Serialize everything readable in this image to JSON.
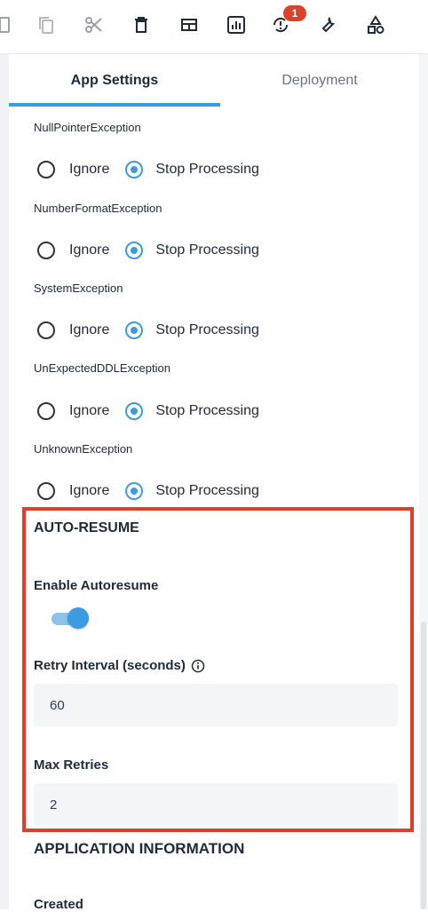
{
  "toolbar": {
    "icons": [
      "document-icon",
      "copy-icon",
      "cut-icon",
      "delete-icon",
      "layout-icon",
      "chart-icon",
      "sync-alert-icon",
      "wrench-icon",
      "shapes-icon"
    ],
    "badge_count": "1"
  },
  "tabs": [
    {
      "label": "App Settings",
      "active": true
    },
    {
      "label": "Deployment",
      "active": false
    }
  ],
  "exceptions": [
    {
      "name": "NullPointerException",
      "options": [
        "Ignore",
        "Stop Processing"
      ],
      "selected": "Stop Processing"
    },
    {
      "name": "NumberFormatException",
      "options": [
        "Ignore",
        "Stop Processing"
      ],
      "selected": "Stop Processing"
    },
    {
      "name": "SystemException",
      "options": [
        "Ignore",
        "Stop Processing"
      ],
      "selected": "Stop Processing"
    },
    {
      "name": "UnExpectedDDLException",
      "options": [
        "Ignore",
        "Stop Processing"
      ],
      "selected": "Stop Processing"
    },
    {
      "name": "UnknownException",
      "options": [
        "Ignore",
        "Stop Processing"
      ],
      "selected": "Stop Processing"
    }
  ],
  "auto_resume": {
    "title": "AUTO-RESUME",
    "enable_label": "Enable Autoresume",
    "enabled": true,
    "retry_interval_label": "Retry Interval (seconds)",
    "retry_interval_value": "60",
    "max_retries_label": "Max Retries",
    "max_retries_value": "2"
  },
  "application_information": {
    "title": "APPLICATION INFORMATION",
    "created_label": "Created"
  },
  "colors": {
    "accent": "#3d9be0",
    "highlight_border": "#e0402a",
    "badge": "#d9452b"
  }
}
